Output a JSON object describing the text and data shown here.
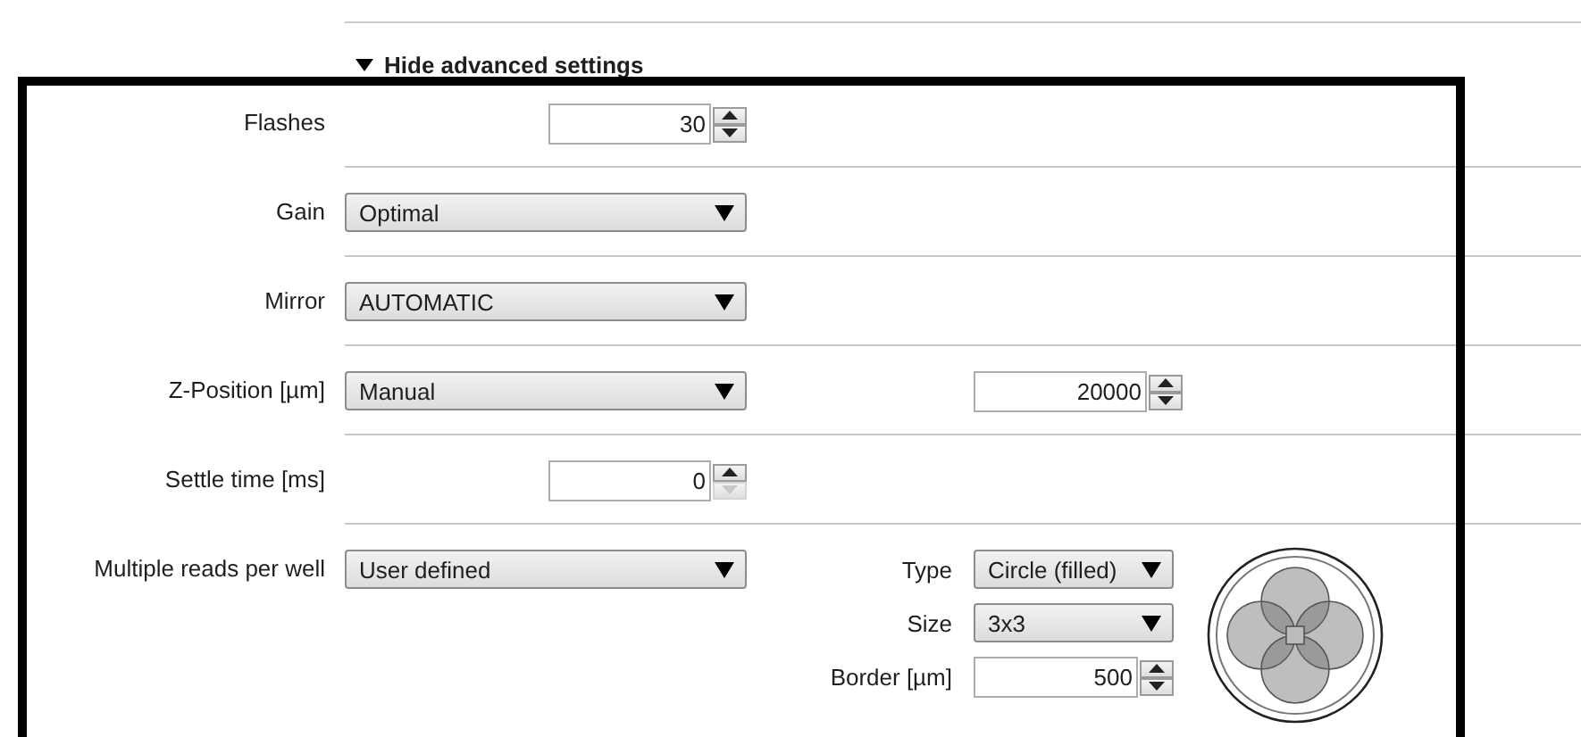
{
  "section_toggle": {
    "label": "Hide advanced settings",
    "expanded": true
  },
  "settings": [
    {
      "kind": "spin",
      "label": "Flashes",
      "value": "30",
      "down_disabled": false
    },
    {
      "kind": "dropdown",
      "label": "Gain",
      "value": "Optimal"
    },
    {
      "kind": "dropdown",
      "label": "Mirror",
      "value": "AUTOMATIC"
    },
    {
      "kind": "dropdown_spin",
      "label": "Z-Position [µm]",
      "value": "Manual",
      "number": "20000",
      "down_disabled": false
    },
    {
      "kind": "spin",
      "label": "Settle time [ms]",
      "value": "0",
      "down_disabled": true
    },
    {
      "kind": "multiple",
      "label": "Multiple reads per well",
      "value": "User defined",
      "options": [
        {
          "kind": "dropdown",
          "label": "Type",
          "value": "Circle (filled)"
        },
        {
          "kind": "dropdown",
          "label": "Size",
          "value": "3x3"
        },
        {
          "kind": "spin",
          "label": "Border [µm]",
          "value": "500",
          "down_disabled": false
        }
      ]
    }
  ]
}
